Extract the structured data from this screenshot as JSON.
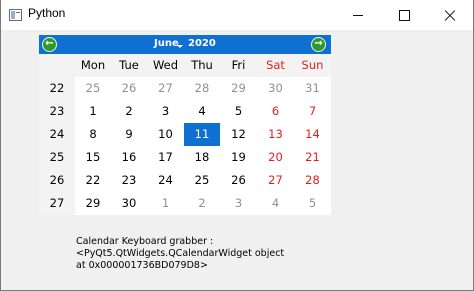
{
  "window": {
    "title": "Python"
  },
  "calendar": {
    "month": "June",
    "year": "2020",
    "weekdays": [
      "Mon",
      "Tue",
      "Wed",
      "Thu",
      "Fri",
      "Sat",
      "Sun"
    ],
    "weeks": [
      {
        "num": "22",
        "days": [
          "25",
          "26",
          "27",
          "28",
          "29",
          "30",
          "31"
        ]
      },
      {
        "num": "23",
        "days": [
          "1",
          "2",
          "3",
          "4",
          "5",
          "6",
          "7"
        ]
      },
      {
        "num": "24",
        "days": [
          "8",
          "9",
          "10",
          "11",
          "12",
          "13",
          "14"
        ]
      },
      {
        "num": "25",
        "days": [
          "15",
          "16",
          "17",
          "18",
          "19",
          "20",
          "21"
        ]
      },
      {
        "num": "26",
        "days": [
          "22",
          "23",
          "24",
          "25",
          "26",
          "27",
          "28"
        ]
      },
      {
        "num": "27",
        "days": [
          "29",
          "30",
          "1",
          "2",
          "3",
          "4",
          "5"
        ]
      }
    ],
    "selected_day": "11",
    "colors": {
      "header": "#0f70d2",
      "selected": "#0f70d2",
      "weekend": "#e0201e",
      "other_month": "#909090",
      "nav_arrow": "#2e9a2e"
    },
    "icons": {
      "prev": "arrow-left-icon",
      "next": "arrow-right-icon"
    }
  },
  "info": {
    "line1": "Calendar Keyboard grabber :",
    "line2": "<PyQt5.QtWidgets.QCalendarWidget object",
    "line3": "at 0x000001736BD079D8>"
  }
}
